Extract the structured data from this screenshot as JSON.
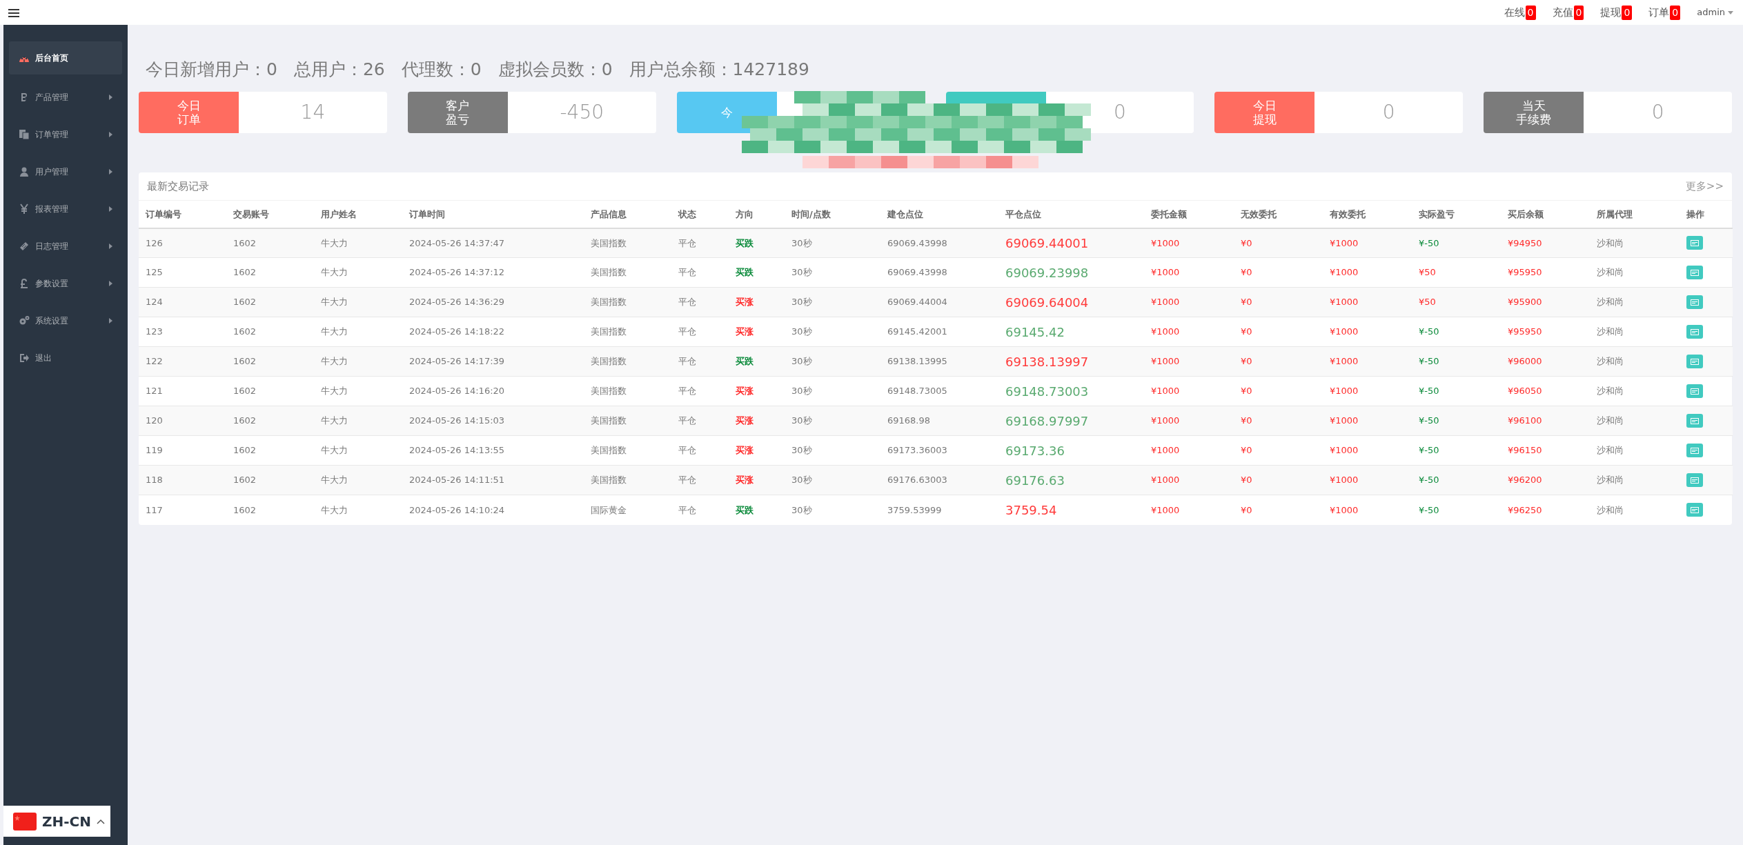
{
  "topbar": {
    "counters": [
      {
        "label": "在线",
        "count": "0"
      },
      {
        "label": "充值",
        "count": "0"
      },
      {
        "label": "提现",
        "count": "0"
      },
      {
        "label": "订单",
        "count": "0"
      }
    ],
    "user": "admin"
  },
  "sidebar": {
    "items": [
      {
        "label": "后台首页",
        "selected": true,
        "kind": "link"
      },
      {
        "label": "产品管理",
        "selected": false,
        "kind": "submenu"
      },
      {
        "label": "订单管理",
        "selected": false,
        "kind": "submenu"
      },
      {
        "label": "用户管理",
        "selected": false,
        "kind": "submenu"
      },
      {
        "label": "报表管理",
        "selected": false,
        "kind": "submenu"
      },
      {
        "label": "日志管理",
        "selected": false,
        "kind": "submenu"
      },
      {
        "label": "参数设置",
        "selected": false,
        "kind": "submenu"
      },
      {
        "label": "系统设置",
        "selected": false,
        "kind": "submenu"
      },
      {
        "label": "退出",
        "selected": false,
        "kind": "link"
      }
    ]
  },
  "summary": [
    {
      "label": "今日新增用户：",
      "value": "0"
    },
    {
      "label": "总用户：",
      "value": "26"
    },
    {
      "label": "代理数：",
      "value": "0"
    },
    {
      "label": "虚拟会员数：",
      "value": "0"
    },
    {
      "label": "用户总余额：",
      "value": "1427189"
    }
  ],
  "stat_cards": [
    {
      "label_lines": [
        "今日",
        "订单"
      ],
      "value": "14",
      "color": "#ff6c60"
    },
    {
      "label_lines": [
        "客户",
        "盈亏"
      ],
      "value": "-450",
      "color": "#7b7b7b"
    },
    {
      "label_lines": [
        "今"
      ],
      "color": "#57c8f2"
    },
    {
      "value": "0",
      "color": "#41cac0"
    },
    {
      "label_lines": [
        "今日",
        "提现"
      ],
      "value": "0",
      "color": "#ff6c60"
    },
    {
      "label_lines": [
        "当天",
        "手续费"
      ],
      "value": "0",
      "color": "#7b7b7b"
    }
  ],
  "table": {
    "title": "最新交易记录",
    "more": "更多>>",
    "columns": [
      "订单编号",
      "交易账号",
      "用户姓名",
      "订单时间",
      "产品信息",
      "状态",
      "方向",
      "时间/点数",
      "建仓点位",
      "平仓点位",
      "委托金额",
      "无效委托",
      "有效委托",
      "实际盈亏",
      "买后余额",
      "所属代理",
      "操作"
    ],
    "rows": [
      {
        "id": "126",
        "account": "1602",
        "name": "牛大力",
        "time": "2024-05-26 14:37:47",
        "product": "美国指数",
        "status": "平仓",
        "direction": {
          "text": "买跌",
          "color": "#0a8a3a"
        },
        "duration": "30秒",
        "open": "69069.43998",
        "close": {
          "text": "69069.44001",
          "color": "#ff3b3b"
        },
        "amount": "¥1000",
        "invalid": "¥0",
        "valid": "¥1000",
        "profit": {
          "text": "¥-50",
          "color": "#0a8a3a"
        },
        "balance": "¥94950",
        "agent": "沙和尚"
      },
      {
        "id": "125",
        "account": "1602",
        "name": "牛大力",
        "time": "2024-05-26 14:37:12",
        "product": "美国指数",
        "status": "平仓",
        "direction": {
          "text": "买跌",
          "color": "#0a8a3a"
        },
        "duration": "30秒",
        "open": "69069.43998",
        "close": {
          "text": "69069.23998",
          "color": "#5aaa70"
        },
        "amount": "¥1000",
        "invalid": "¥0",
        "valid": "¥1000",
        "profit": {
          "text": "¥50",
          "color": "#ff2a2a"
        },
        "balance": "¥95950",
        "agent": "沙和尚"
      },
      {
        "id": "124",
        "account": "1602",
        "name": "牛大力",
        "time": "2024-05-26 14:36:29",
        "product": "美国指数",
        "status": "平仓",
        "direction": {
          "text": "买涨",
          "color": "#ff2a2a"
        },
        "duration": "30秒",
        "open": "69069.44004",
        "close": {
          "text": "69069.64004",
          "color": "#ff3b3b"
        },
        "amount": "¥1000",
        "invalid": "¥0",
        "valid": "¥1000",
        "profit": {
          "text": "¥50",
          "color": "#ff2a2a"
        },
        "balance": "¥95900",
        "agent": "沙和尚"
      },
      {
        "id": "123",
        "account": "1602",
        "name": "牛大力",
        "time": "2024-05-26 14:18:22",
        "product": "美国指数",
        "status": "平仓",
        "direction": {
          "text": "买涨",
          "color": "#ff2a2a"
        },
        "duration": "30秒",
        "open": "69145.42001",
        "close": {
          "text": "69145.42",
          "color": "#5aaa70"
        },
        "amount": "¥1000",
        "invalid": "¥0",
        "valid": "¥1000",
        "profit": {
          "text": "¥-50",
          "color": "#0a8a3a"
        },
        "balance": "¥95950",
        "agent": "沙和尚"
      },
      {
        "id": "122",
        "account": "1602",
        "name": "牛大力",
        "time": "2024-05-26 14:17:39",
        "product": "美国指数",
        "status": "平仓",
        "direction": {
          "text": "买跌",
          "color": "#0a8a3a"
        },
        "duration": "30秒",
        "open": "69138.13995",
        "close": {
          "text": "69138.13997",
          "color": "#ff3b3b"
        },
        "amount": "¥1000",
        "invalid": "¥0",
        "valid": "¥1000",
        "profit": {
          "text": "¥-50",
          "color": "#0a8a3a"
        },
        "balance": "¥96000",
        "agent": "沙和尚"
      },
      {
        "id": "121",
        "account": "1602",
        "name": "牛大力",
        "time": "2024-05-26 14:16:20",
        "product": "美国指数",
        "status": "平仓",
        "direction": {
          "text": "买涨",
          "color": "#ff2a2a"
        },
        "duration": "30秒",
        "open": "69148.73005",
        "close": {
          "text": "69148.73003",
          "color": "#5aaa70"
        },
        "amount": "¥1000",
        "invalid": "¥0",
        "valid": "¥1000",
        "profit": {
          "text": "¥-50",
          "color": "#0a8a3a"
        },
        "balance": "¥96050",
        "agent": "沙和尚"
      },
      {
        "id": "120",
        "account": "1602",
        "name": "牛大力",
        "time": "2024-05-26 14:15:03",
        "product": "美国指数",
        "status": "平仓",
        "direction": {
          "text": "买涨",
          "color": "#ff2a2a"
        },
        "duration": "30秒",
        "open": "69168.98",
        "close": {
          "text": "69168.97997",
          "color": "#5aaa70"
        },
        "amount": "¥1000",
        "invalid": "¥0",
        "valid": "¥1000",
        "profit": {
          "text": "¥-50",
          "color": "#0a8a3a"
        },
        "balance": "¥96100",
        "agent": "沙和尚"
      },
      {
        "id": "119",
        "account": "1602",
        "name": "牛大力",
        "time": "2024-05-26 14:13:55",
        "product": "美国指数",
        "status": "平仓",
        "direction": {
          "text": "买涨",
          "color": "#ff2a2a"
        },
        "duration": "30秒",
        "open": "69173.36003",
        "close": {
          "text": "69173.36",
          "color": "#5aaa70"
        },
        "amount": "¥1000",
        "invalid": "¥0",
        "valid": "¥1000",
        "profit": {
          "text": "¥-50",
          "color": "#0a8a3a"
        },
        "balance": "¥96150",
        "agent": "沙和尚"
      },
      {
        "id": "118",
        "account": "1602",
        "name": "牛大力",
        "time": "2024-05-26 14:11:51",
        "product": "美国指数",
        "status": "平仓",
        "direction": {
          "text": "买涨",
          "color": "#ff2a2a"
        },
        "duration": "30秒",
        "open": "69176.63003",
        "close": {
          "text": "69176.63",
          "color": "#5aaa70"
        },
        "amount": "¥1000",
        "invalid": "¥0",
        "valid": "¥1000",
        "profit": {
          "text": "¥-50",
          "color": "#0a8a3a"
        },
        "balance": "¥96200",
        "agent": "沙和尚"
      },
      {
        "id": "117",
        "account": "1602",
        "name": "牛大力",
        "time": "2024-05-26 14:10:24",
        "product": "国际黄金",
        "status": "平仓",
        "direction": {
          "text": "买跌",
          "color": "#0a8a3a"
        },
        "duration": "30秒",
        "open": "3759.53999",
        "close": {
          "text": "3759.54",
          "color": "#ff3b3b"
        },
        "amount": "¥1000",
        "invalid": "¥0",
        "valid": "¥1000",
        "profit": {
          "text": "¥-50",
          "color": "#0a8a3a"
        },
        "balance": "¥96250",
        "agent": "沙和尚"
      }
    ]
  },
  "language": {
    "label": "ZH-CN"
  }
}
